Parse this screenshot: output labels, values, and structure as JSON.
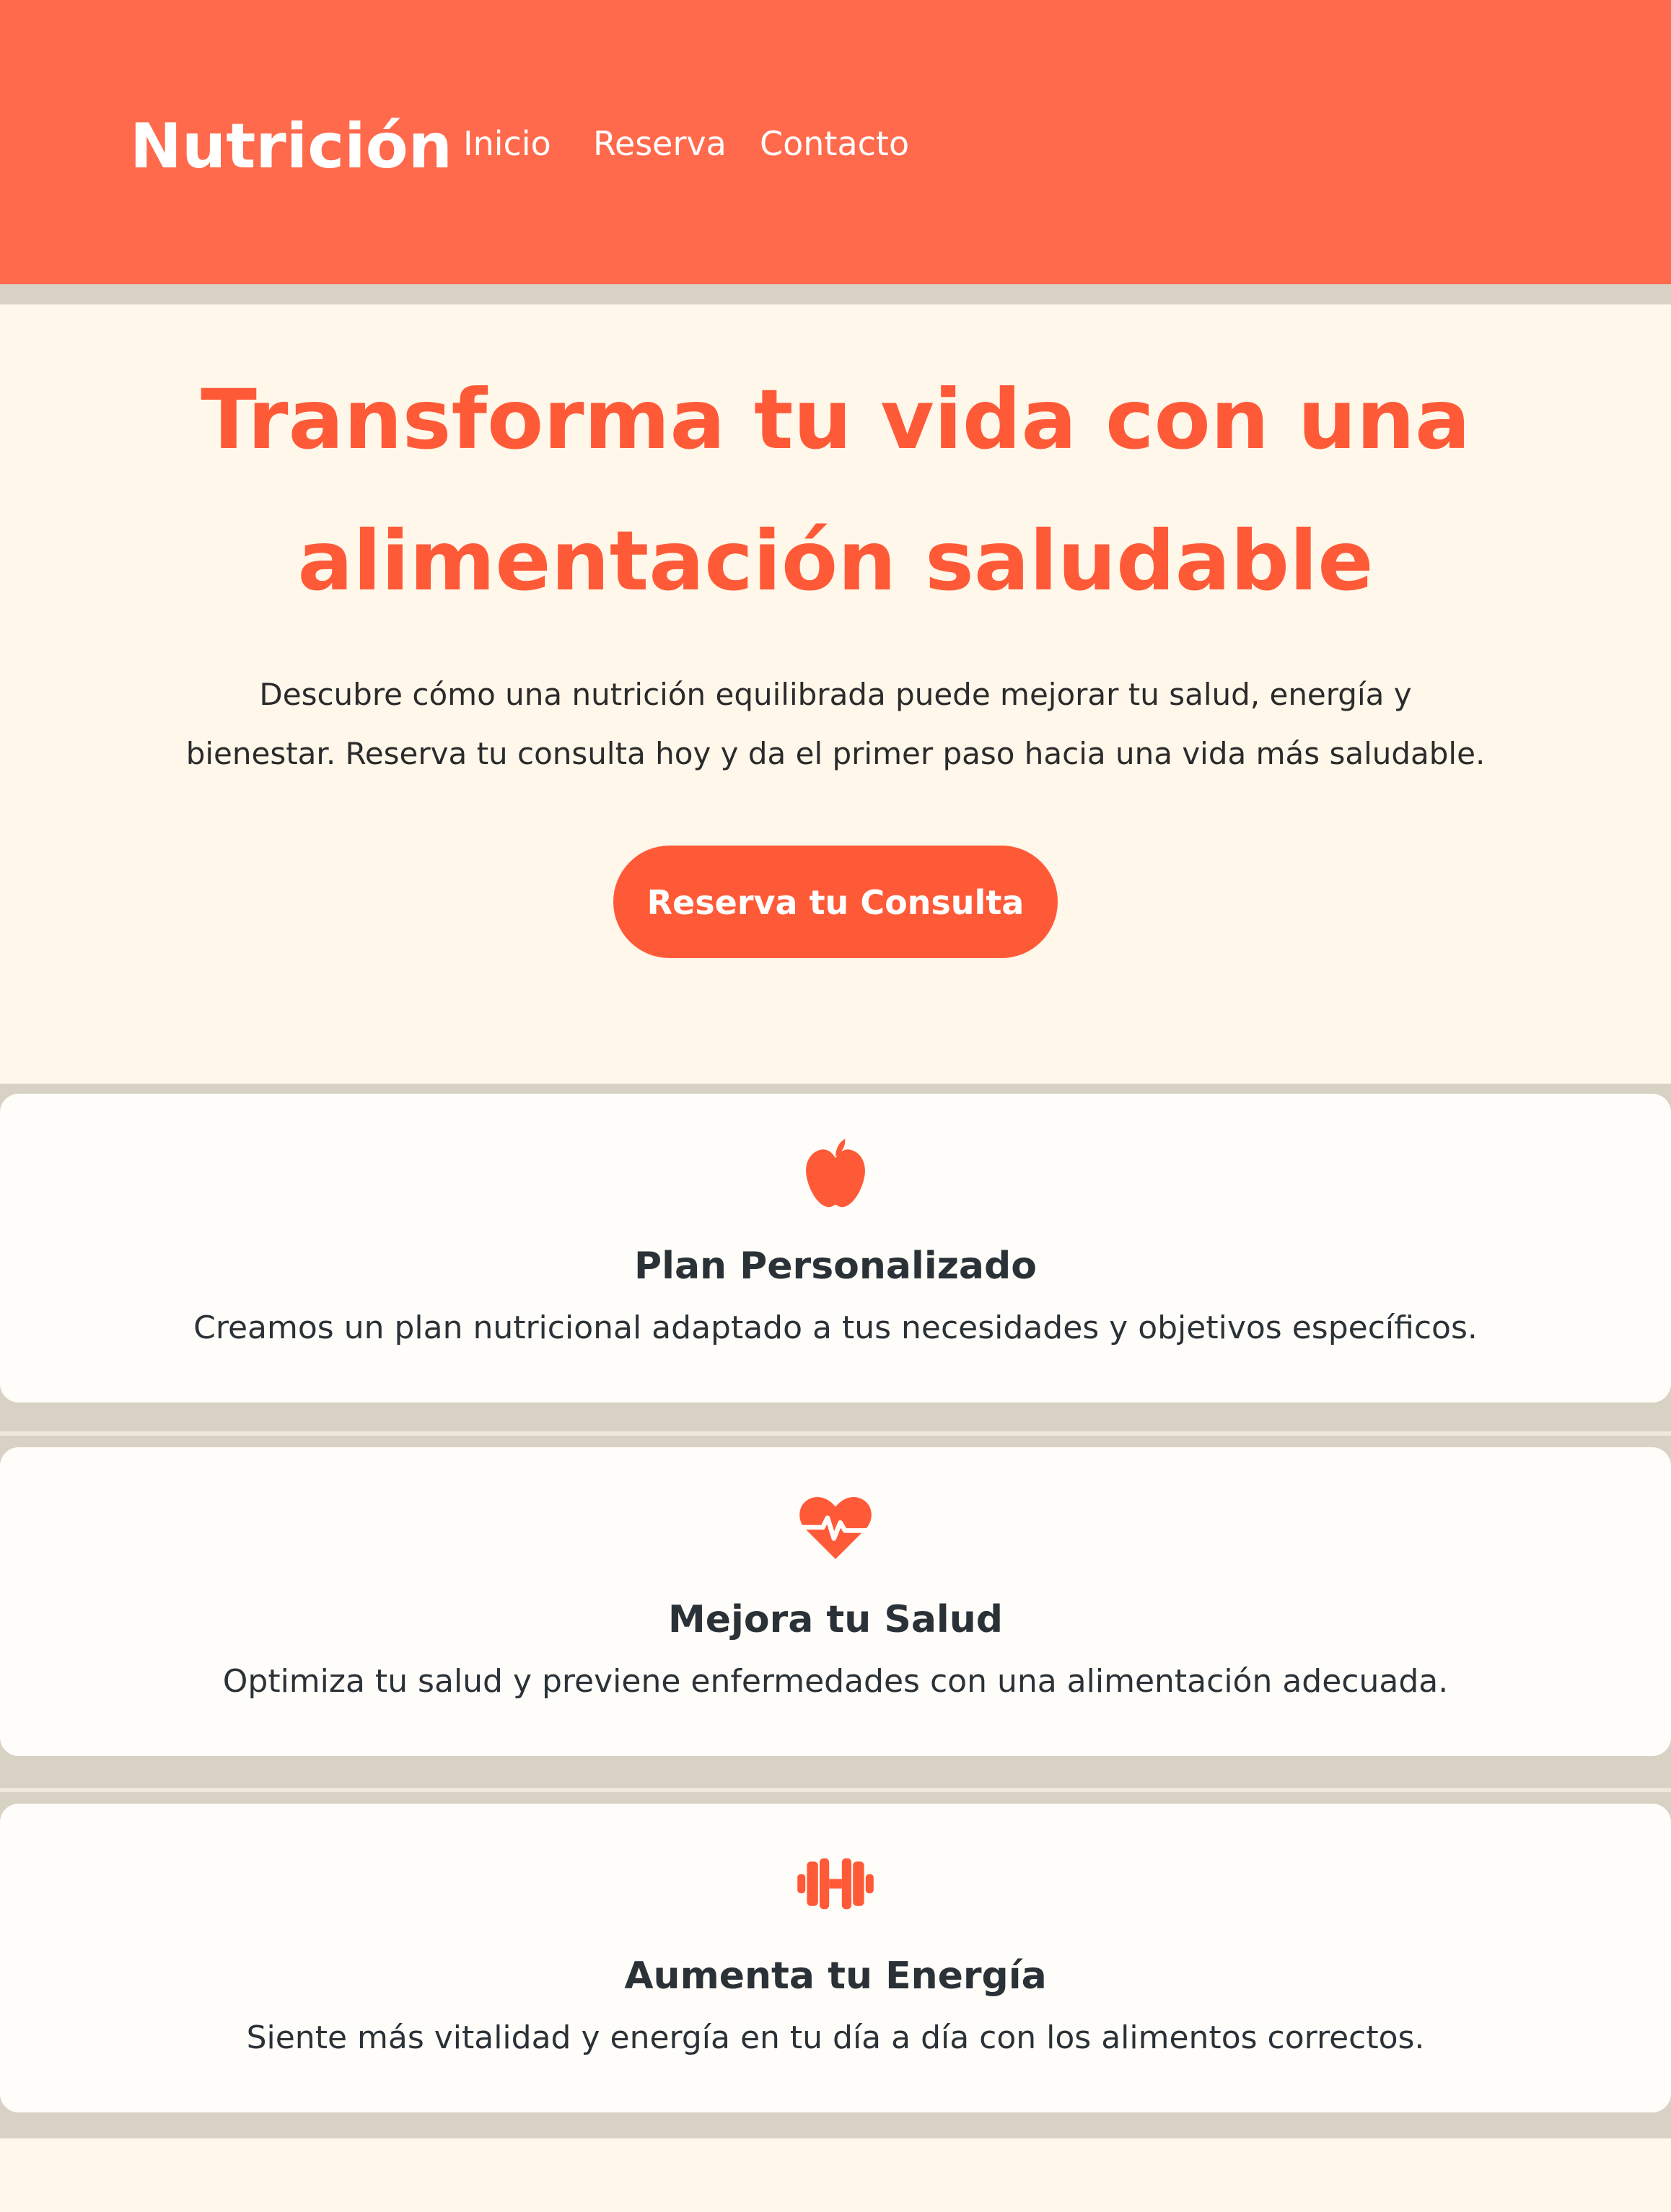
{
  "header": {
    "brand": "Nutrición",
    "nav": [
      "Inicio",
      "Reserva",
      "Contacto"
    ]
  },
  "hero": {
    "title_line1": "Transforma tu vida con una",
    "title_line2": "alimentación saludable",
    "text_line1": "Descubre cómo una nutrición equilibrada puede mejorar tu salud, energía y",
    "text_line2": "bienestar. Reserva tu consulta hoy y da el primer paso hacia una vida más saludable.",
    "cta": "Reserva tu Consulta"
  },
  "features": [
    {
      "icon": "apple-icon",
      "title": "Plan Personalizado",
      "description": "Creamos un plan nutricional adaptado a tus necesidades y objetivos específicos."
    },
    {
      "icon": "heart-pulse-icon",
      "title": "Mejora tu Salud",
      "description": "Optimiza tu salud y previene enfermedades con una alimentación adecuada."
    },
    {
      "icon": "dumbbell-icon",
      "title": "Aumenta tu Energía",
      "description": "Siente más vitalidad y energía en tu día a día con los alimentos correctos."
    }
  ],
  "colors": {
    "header_bg": "#ff6a4c",
    "accent": "#ff5a38",
    "page_bg": "#fff7ea",
    "card_bg": "#fffdf9",
    "separator": "#d8d2c4",
    "text_dark": "#2b3237"
  }
}
